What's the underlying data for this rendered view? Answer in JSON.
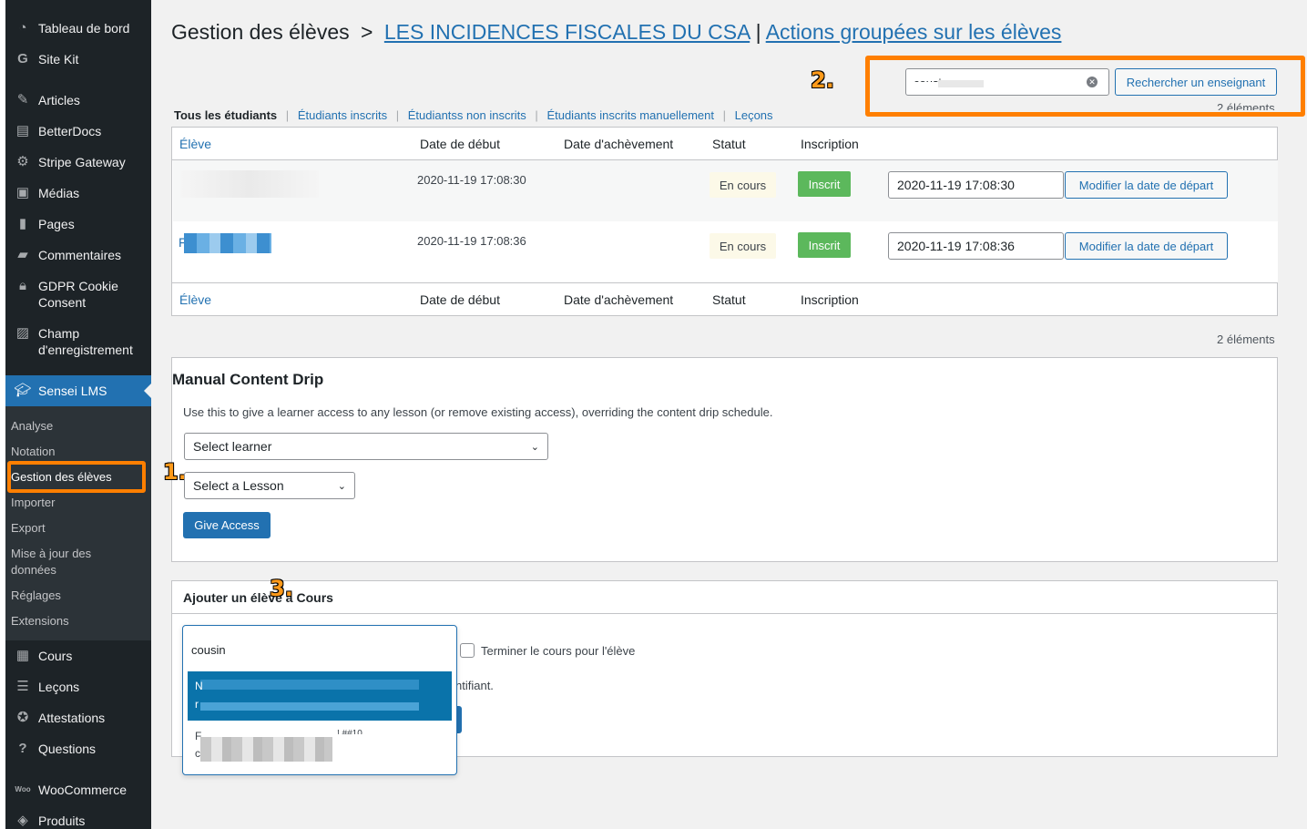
{
  "sidebar": {
    "items": [
      {
        "label": "Tableau de bord",
        "icon": "dashboard-icon",
        "glyph": "◔"
      },
      {
        "label": "Site Kit",
        "icon": "sitekit-icon",
        "glyph": "G"
      },
      {
        "label": "Articles",
        "icon": "pin-icon",
        "glyph": "✎"
      },
      {
        "label": "BetterDocs",
        "icon": "docs-icon",
        "glyph": "▤"
      },
      {
        "label": "Stripe Gateway",
        "icon": "gear-icon",
        "glyph": "⚙"
      },
      {
        "label": "Médias",
        "icon": "media-icon",
        "glyph": "▣"
      },
      {
        "label": "Pages",
        "icon": "pages-icon",
        "glyph": "▮"
      },
      {
        "label": "Commentaires",
        "icon": "comment-icon",
        "glyph": "▰"
      },
      {
        "label": "GDPR Cookie Consent",
        "icon": "lock-icon",
        "glyph": "🔒︎"
      },
      {
        "label": "Champ d'enregistrement",
        "icon": "form-icon",
        "glyph": "▨"
      },
      {
        "label": "Sensei LMS",
        "icon": "graduation-cap-icon",
        "glyph": "🎓︎"
      },
      {
        "label": "Cours",
        "icon": "courses-icon",
        "glyph": "▦"
      },
      {
        "label": "Leçons",
        "icon": "lessons-icon",
        "glyph": "☰"
      },
      {
        "label": "Attestations",
        "icon": "award-icon",
        "glyph": "✪"
      },
      {
        "label": "Questions",
        "icon": "question-icon",
        "glyph": "?"
      },
      {
        "label": "WooCommerce",
        "icon": "woocommerce-icon",
        "glyph": "Woo"
      },
      {
        "label": "Produits",
        "icon": "box-icon",
        "glyph": "◈"
      }
    ],
    "submenu": [
      "Analyse",
      "Notation",
      "Gestion des élèves",
      "Importer",
      "Export",
      "Mise à jour des données",
      "Réglages",
      "Extensions"
    ]
  },
  "header": {
    "title_prefix": "Gestion des élèves",
    "title_sep": ">",
    "course_link": "LES INCIDENCES FISCALES DU CSA",
    "pipe": "|",
    "bulk_link": "Actions groupées sur les élèves"
  },
  "search": {
    "value": "cousin",
    "button": "Rechercher un enseignant",
    "count_top": "2 éléments"
  },
  "steps": {
    "one": "1.",
    "two": "2.",
    "three": "3."
  },
  "filters": {
    "current": "Tous les étudiants",
    "links": [
      "Étudiants inscrits",
      "Étudiantss non inscrits",
      "Étudiants inscrits manuellement",
      "Leçons"
    ],
    "sep": "|"
  },
  "table": {
    "columns": [
      "Élève",
      "Date de début",
      "Date d'achèvement",
      "Statut",
      "Inscription"
    ],
    "rows": [
      {
        "start": "2020-11-19 17:08:30",
        "status": "En cours",
        "enrollment": "Inscrit",
        "start_input": "2020-11-19 17:08:30",
        "action": "Modifier la date de départ"
      },
      {
        "student_initial": "F",
        "start": "2020-11-19 17:08:36",
        "status": "En cours",
        "enrollment": "Inscrit",
        "start_input": "2020-11-19 17:08:36",
        "action": "Modifier la date de départ"
      }
    ],
    "count_bottom": "2 éléments"
  },
  "manual_drip": {
    "title": "Manual Content Drip",
    "description": "Use this to give a learner access to any lesson (or remove existing access), overriding the content drip schedule.",
    "learner_select": "Select learner",
    "lesson_select": "Select a Lesson",
    "button": "Give Access"
  },
  "add_student": {
    "title": "Ajouter un élève à Cours",
    "checkbox_label": "Terminer le cours pour l'élève",
    "partial_text": "ntifiant.",
    "dropdown": {
      "search": "cousin",
      "selected_glyph_1": "N",
      "selected_glyph_2": "r",
      "option_line_1": "F",
      "option_line_2": "c",
      "option_fragment": "! ##10"
    }
  },
  "colors": {
    "accent": "#2271b1",
    "highlight": "#ff7f00",
    "sidebar": "#1d2327",
    "success": "#5cb85c"
  }
}
